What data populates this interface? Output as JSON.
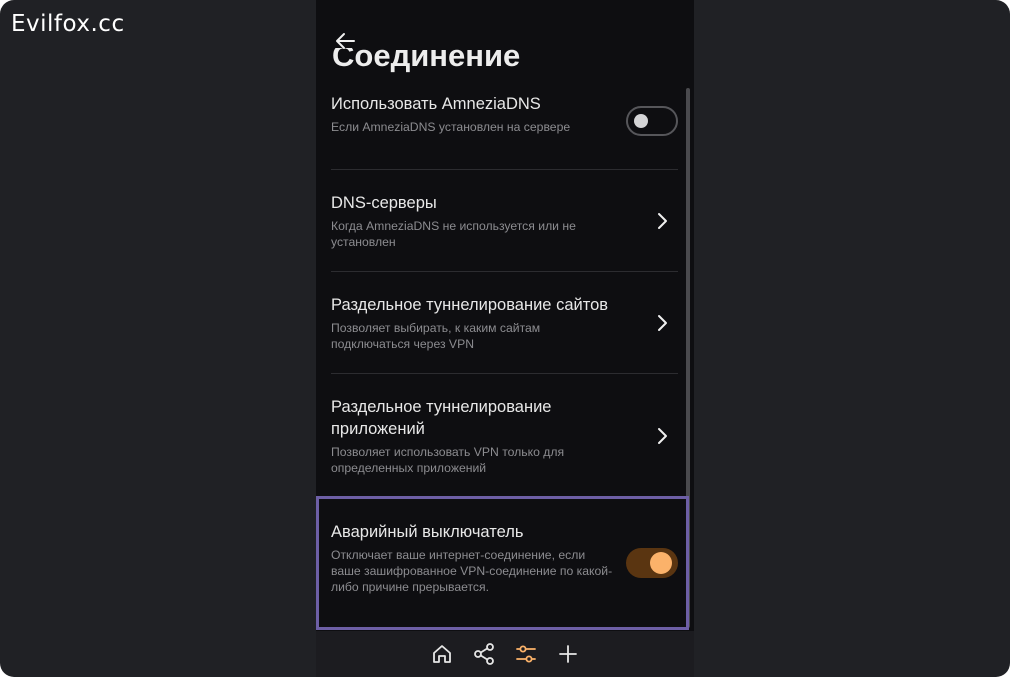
{
  "watermark": "Evilfox.cc",
  "page": {
    "title": "Соединение"
  },
  "settings": [
    {
      "title": "Использовать AmneziaDNS",
      "desc": "Если AmneziaDNS установлен на сервере",
      "control": "toggle",
      "state": "off"
    },
    {
      "title": "DNS-серверы",
      "desc": "Когда AmneziaDNS не используется или не установлен",
      "control": "chevron"
    },
    {
      "title": "Раздельное туннелирование сайтов",
      "desc": "Позволяет выбирать, к каким сайтам подключаться через VPN",
      "control": "chevron"
    },
    {
      "title": "Раздельное туннелирование приложений",
      "desc": "Позволяет использовать VPN только для определенных приложений",
      "control": "chevron"
    },
    {
      "title": "Аварийный выключатель",
      "desc": "Отключает ваше интернет-соединение, если ваше зашифрованное VPN-соединение по какой-либо причине прерывается.",
      "control": "toggle",
      "state": "on"
    }
  ],
  "nav": [
    {
      "icon": "home-icon",
      "active": false
    },
    {
      "icon": "share-icon",
      "active": false
    },
    {
      "icon": "settings-sliders-icon",
      "active": true
    },
    {
      "icon": "plus-icon",
      "active": false
    }
  ],
  "colors": {
    "accent": "#fbb26a",
    "toggle_on_track": "#5a3511",
    "highlight_border": "#6d5fa6",
    "background": "#0e0e11"
  }
}
